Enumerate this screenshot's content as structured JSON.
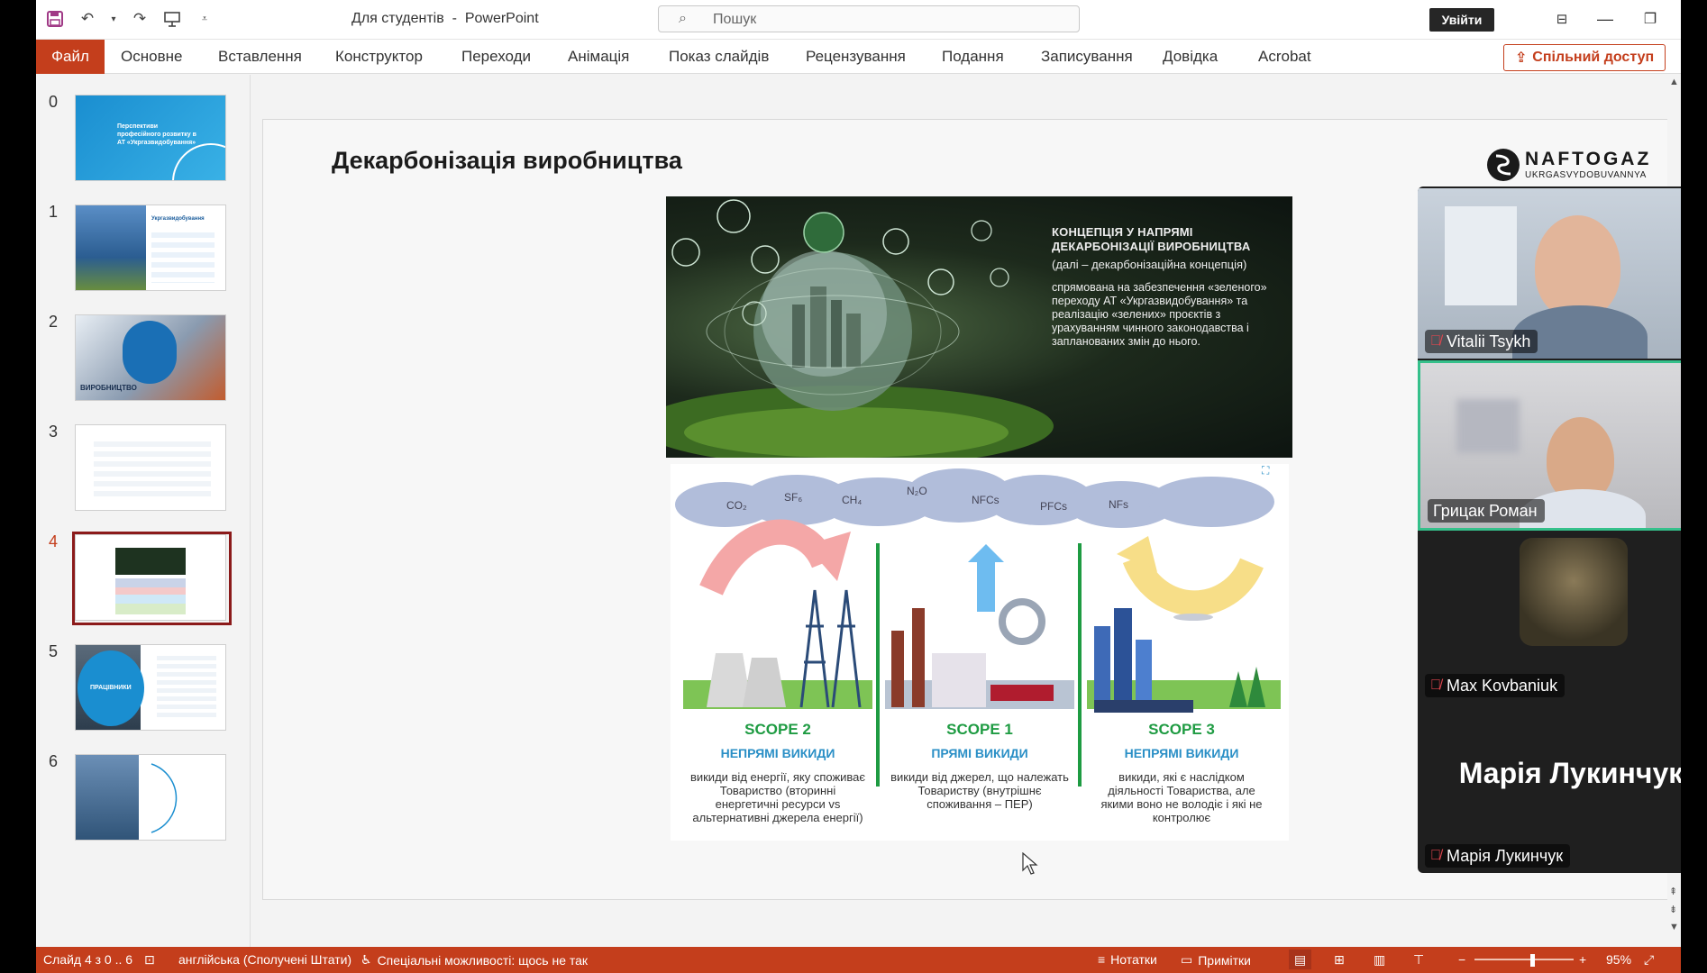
{
  "app": {
    "doc_title": "Для студентів",
    "app_name": "PowerPoint",
    "search_placeholder": "Пошук",
    "signin": "Увійти"
  },
  "ribbon": {
    "tabs": [
      "Файл",
      "Основне",
      "Вставлення",
      "Конструктор",
      "Переходи",
      "Анімація",
      "Показ слайдів",
      "Рецензування",
      "Подання",
      "Записування",
      "Довідка",
      "Acrobat"
    ],
    "share": "Спільний доступ"
  },
  "thumbnails": [
    {
      "num": "0",
      "text": "Перспективи професійного розвитку в АТ «Укргазвидобування»"
    },
    {
      "num": "1",
      "text": "Укргазвидобування"
    },
    {
      "num": "2",
      "text": "ВИРОБНИЦТВО"
    },
    {
      "num": "3",
      "text": ""
    },
    {
      "num": "4",
      "text": ""
    },
    {
      "num": "5",
      "text": "ПРАЦІВНИКИ"
    },
    {
      "num": "6",
      "text": ""
    }
  ],
  "selected_thumb": 4,
  "slide": {
    "title": "Декарбонізація виробництва",
    "logo_name": "NAFTOGAZ",
    "logo_sub": "UKRGASVYDOBUVANNYA",
    "concept": {
      "head": "КОНЦЕПЦІЯ У НАПРЯМІ ДЕКАРБОНІЗАЦІЇ ВИРОБНИЦТВА",
      "sub": "(далі – декарбонізаційна концепція)",
      "body": "спрямована на забезпечення «зеленого» переходу АТ «Укргазвидобування» та реалізацію «зелених» проєктів з урахуванням чинного законодавства і запланованих змін до нього."
    },
    "gases": [
      "CO₂",
      "SF₆",
      "CH₄",
      "N₂O",
      "NFCs",
      "PFCs",
      "NFs"
    ],
    "scopes": [
      {
        "title": "SCOPE 2",
        "kind": "НЕПРЯМІ ВИКИДИ",
        "desc": "викиди від енергії, яку споживає Товариство (вторинні енергетичні ресурси vs альтернативні джерела енергії)"
      },
      {
        "title": "SCOPE 1",
        "kind": "ПРЯМІ ВИКИДИ",
        "desc": "викиди від джерел, що належать Товариству (внутрішнє споживання – ПЕР)"
      },
      {
        "title": "SCOPE 3",
        "kind": "НЕПРЯМІ ВИКИДИ",
        "desc": "викиди, які є наслідком діяльності Товариства, але якими воно не володіє і які не контролює"
      }
    ]
  },
  "participants": [
    {
      "name": "Vitalii Tsykh"
    },
    {
      "name": "Грицак Роман"
    },
    {
      "name": "Max Kovbaniuk"
    },
    {
      "name": "Марія Лукинчук",
      "display": "Марія Лукинчук"
    }
  ],
  "status": {
    "slide_info": "Слайд 4 з 0 .. 6",
    "language": "англійська (Сполучені Штати)",
    "accessibility": "Спеціальні можливості: щось не так",
    "notes": "Нотатки",
    "comments": "Примітки",
    "zoom": "95%"
  },
  "colors": {
    "accent": "#c43e1c",
    "scope_green": "#1e9b42",
    "scope_blue": "#2a8fc6",
    "active_speaker": "#35c08b"
  }
}
